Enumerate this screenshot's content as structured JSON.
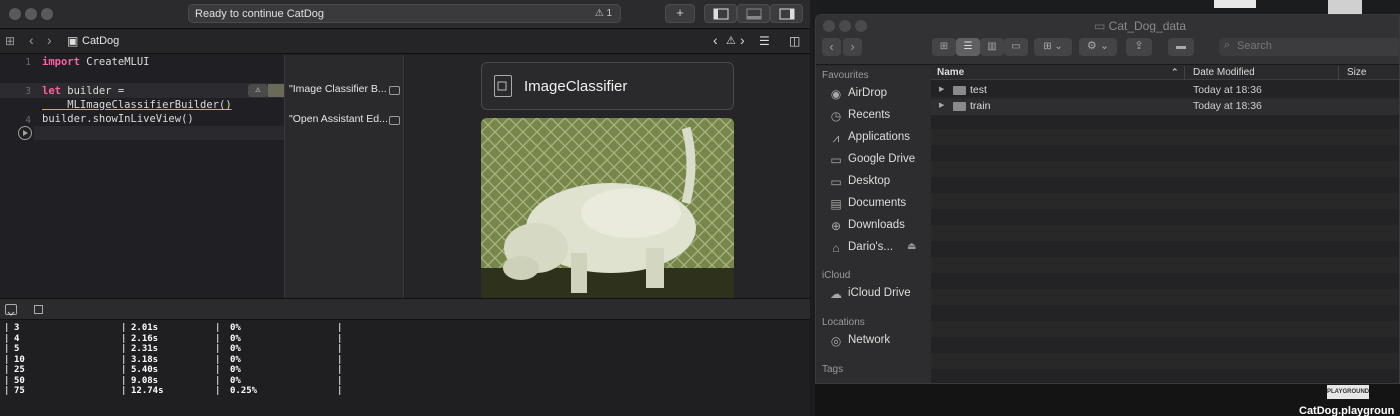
{
  "xcode": {
    "activity_status": "Ready to continue CatDog",
    "activity_warning_count": "1",
    "breadcrumb_file": "CatDog",
    "add_button": "+",
    "code_lines": [
      {
        "num": "1",
        "kw": "import",
        "text": " CreateMLUI"
      },
      {
        "num": "",
        "kw": "",
        "text": ""
      },
      {
        "num": "3",
        "kw": "let",
        "text": " builder ="
      },
      {
        "num": "",
        "kw": "",
        "text": "    MLImageClassifierBuilder()"
      },
      {
        "num": "4",
        "kw": "",
        "text": "builder.showInLiveView()"
      }
    ],
    "results": [
      "\"Image Classifier B...",
      "\"Open Assistant Ed..."
    ],
    "live_view_title": "ImageClassifier",
    "console_rows": [
      {
        "iter": "3",
        "time": "2.01s",
        "pct": "0%"
      },
      {
        "iter": "4",
        "time": "2.16s",
        "pct": "0%"
      },
      {
        "iter": "5",
        "time": "2.31s",
        "pct": "0%"
      },
      {
        "iter": "10",
        "time": "3.18s",
        "pct": "0%"
      },
      {
        "iter": "25",
        "time": "5.40s",
        "pct": "0%"
      },
      {
        "iter": "50",
        "time": "9.08s",
        "pct": "0%"
      },
      {
        "iter": "75",
        "time": "12.74s",
        "pct": "0.25%"
      }
    ]
  },
  "finder": {
    "title": "Cat_Dog_data",
    "search_placeholder": "Search",
    "sections": {
      "favourites": "Favourites",
      "icloud": "iCloud",
      "locations": "Locations",
      "tags": "Tags"
    },
    "favourites": [
      {
        "label": "AirDrop",
        "icon": "airdrop-icon",
        "glyph": "◉"
      },
      {
        "label": "Recents",
        "icon": "clock-icon",
        "glyph": "◷"
      },
      {
        "label": "Applications",
        "icon": "applications-icon",
        "glyph": "⩘"
      },
      {
        "label": "Google Drive",
        "icon": "folder-icon",
        "glyph": "▭"
      },
      {
        "label": "Desktop",
        "icon": "desktop-icon",
        "glyph": "▭"
      },
      {
        "label": "Documents",
        "icon": "document-icon",
        "glyph": "▤"
      },
      {
        "label": "Downloads",
        "icon": "download-icon",
        "glyph": "⊕"
      },
      {
        "label": "Dario's...",
        "icon": "home-icon",
        "glyph": "⌂"
      }
    ],
    "icloud_items": [
      {
        "label": "iCloud Drive",
        "icon": "cloud-icon",
        "glyph": "☁"
      }
    ],
    "location_items": [
      {
        "label": "Network",
        "icon": "network-icon",
        "glyph": "◎"
      }
    ],
    "columns": {
      "name": "Name",
      "date": "Date Modified",
      "size": "Size"
    },
    "files": [
      {
        "name": "test",
        "date": "Today at 18:36"
      },
      {
        "name": "train",
        "date": "Today at 18:36"
      }
    ]
  },
  "desktop": {
    "file_label": "CatDog.playgroun",
    "file_badge": "PLAYGROUND"
  }
}
